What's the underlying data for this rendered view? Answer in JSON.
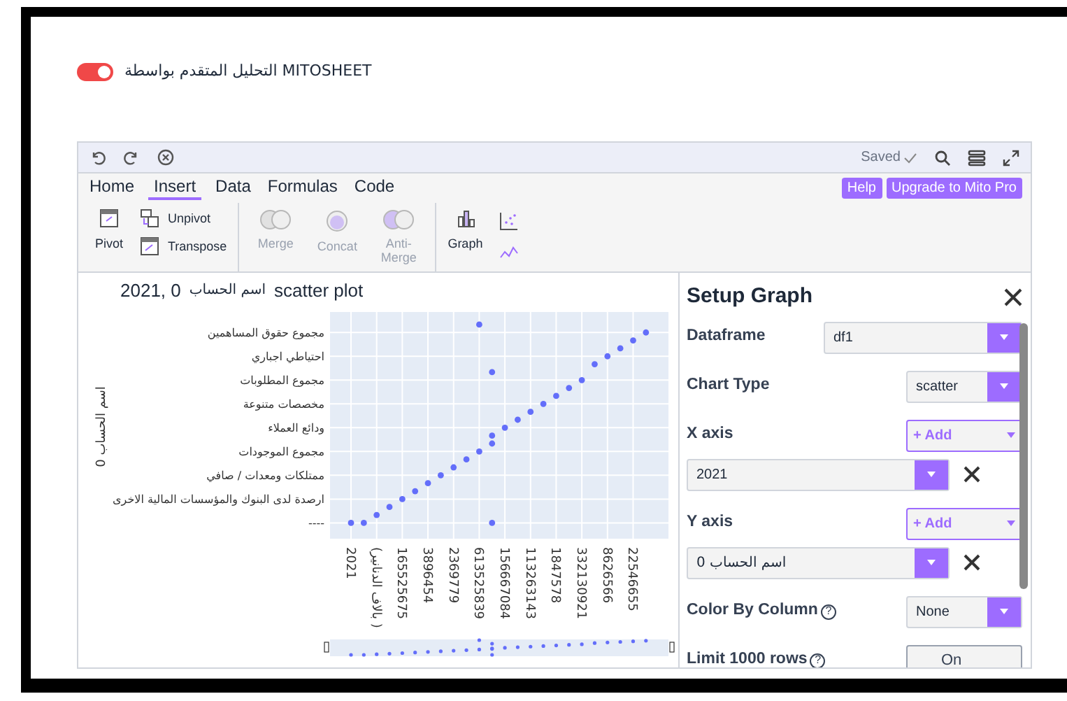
{
  "header": {
    "toggle_on": true,
    "title": "التحليل المتقدم بواسطة MITOSHEET"
  },
  "toolbar": {
    "status": "Saved"
  },
  "menu_tabs": [
    {
      "label": "Home",
      "selected": false
    },
    {
      "label": "Insert",
      "selected": true
    },
    {
      "label": "Data",
      "selected": false
    },
    {
      "label": "Formulas",
      "selected": false
    },
    {
      "label": "Code",
      "selected": false
    }
  ],
  "menu_buttons": [
    "Help",
    "Upgrade to Mito Pro"
  ],
  "ribbon": [
    {
      "kind": "pivot",
      "label": "Pivot",
      "disabled": false
    },
    {
      "kind": "unpivot",
      "label": "Unpivot",
      "disabled": false
    },
    {
      "kind": "transpose",
      "label": "Transpose",
      "disabled": false
    },
    {
      "kind": "merge",
      "label": "Merge",
      "disabled": true
    },
    {
      "kind": "concat",
      "label": "Concat",
      "disabled": true
    },
    {
      "kind": "antimerge",
      "label": "Anti-Merge",
      "disabled": true
    },
    {
      "kind": "graph",
      "label": "Graph",
      "disabled": false
    },
    {
      "kind": "scatter",
      "disabled": false
    },
    {
      "kind": "line",
      "disabled": false
    }
  ],
  "chart": {
    "title_parts": [
      "2021, 0",
      "اسم الحساب",
      "scatter plot"
    ],
    "ylabel": "اسم الحساب 0",
    "y_tick_labels": [
      "مجموع حقوق المساهمين",
      "احتياطي اجباري",
      "مجموع المطلوبات",
      "مخصصات متنوعة",
      "ودائع العملاء",
      "مجموع الموجودات",
      "ممتلكات ومعدات / صافي",
      "ارصدة لدى البنوك والمؤسسات المالية الاخرى",
      "----"
    ],
    "x_tick_labels": [
      "2021",
      "(بالاف الدنانير )",
      "165525675",
      "3896454",
      "2369779",
      "613525839",
      "156667084",
      "113263143",
      "1847578",
      "332130921",
      "8626566",
      "22546655"
    ]
  },
  "panel": {
    "title": "Setup Graph",
    "dataframe": {
      "label": "Dataframe",
      "value": "df1"
    },
    "chart_type": {
      "label": "Chart Type",
      "value": "scatter"
    },
    "x_axis": {
      "label": "X axis",
      "add": "+ Add",
      "columns": [
        "2021"
      ]
    },
    "y_axis": {
      "label": "Y axis",
      "add": "+ Add",
      "columns": [
        "اسم الحساب 0"
      ]
    },
    "color_by": {
      "label": "Color By Column",
      "help": "?",
      "value": "None"
    },
    "limit": {
      "label": "Limit 1000 rows",
      "help": "?",
      "value": "On"
    }
  }
}
